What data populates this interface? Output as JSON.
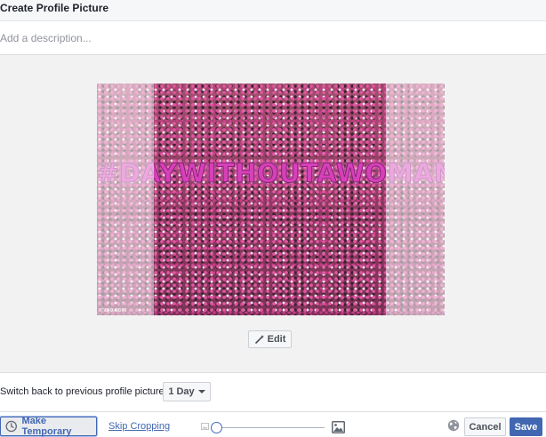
{
  "dialog": {
    "title": "Create Profile Picture"
  },
  "description": {
    "placeholder": "Add a description..."
  },
  "photo": {
    "overlay_text": "#DAYWITHOUTAWOMAN",
    "watermark": "mojo.com",
    "edit_label": "Edit"
  },
  "temporary": {
    "switch_label": "Switch back to previous profile picture in",
    "duration_selected": "1 Day"
  },
  "footer": {
    "make_temporary_label": "Make Temporary",
    "skip_cropping_label": "Skip Cropping",
    "zoom_level": 0,
    "cancel_label": "Cancel",
    "save_label": "Save"
  },
  "colors": {
    "accent": "#4267b2",
    "overlay_text": "#d640b8"
  },
  "icons": [
    "clock-icon",
    "magic-wand-icon",
    "image-small-icon",
    "image-large-icon",
    "globe-icon",
    "chevron-down-icon"
  ]
}
